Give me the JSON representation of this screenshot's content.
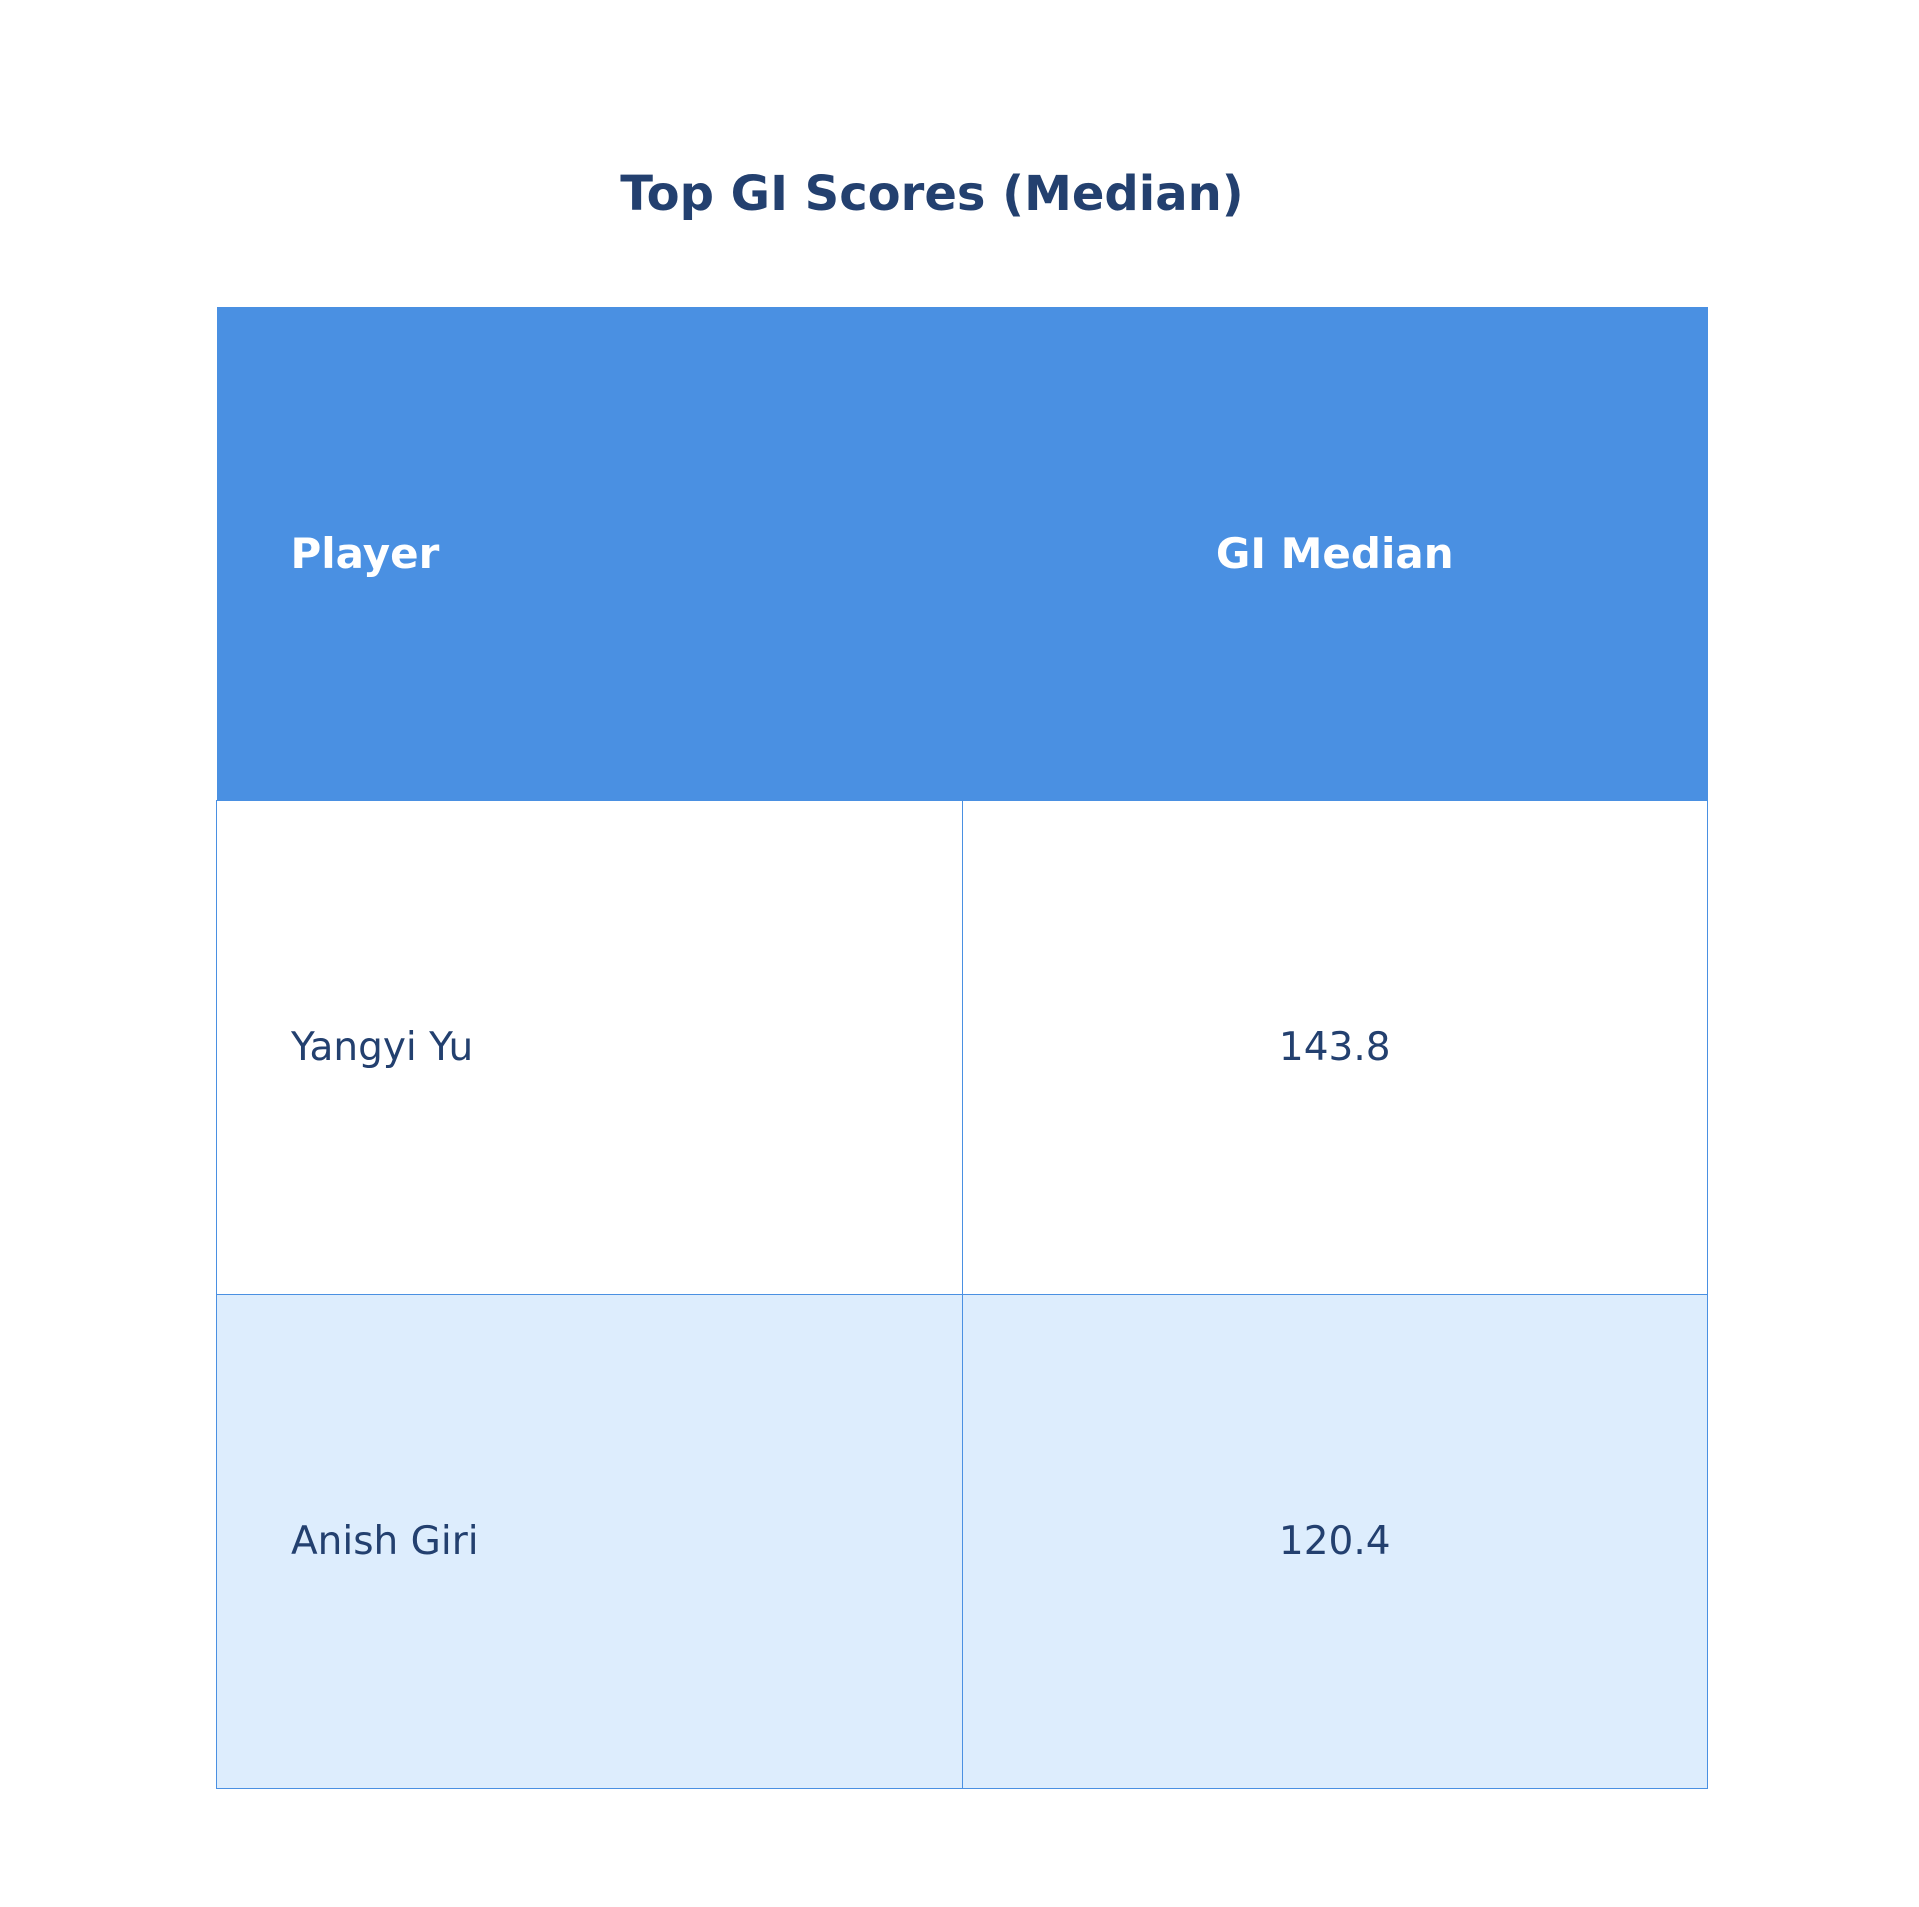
{
  "chart_data": {
    "type": "table",
    "title": "Top GI Scores (Median)",
    "columns": [
      "Player",
      "GI Median"
    ],
    "rows": [
      [
        "Yangyi Yu",
        "143.8"
      ],
      [
        "Anish Giri",
        "120.4"
      ]
    ]
  },
  "colors": {
    "header_bg": "#4a90e2",
    "alt_row": "#ddedfd",
    "text": "#23406f"
  }
}
